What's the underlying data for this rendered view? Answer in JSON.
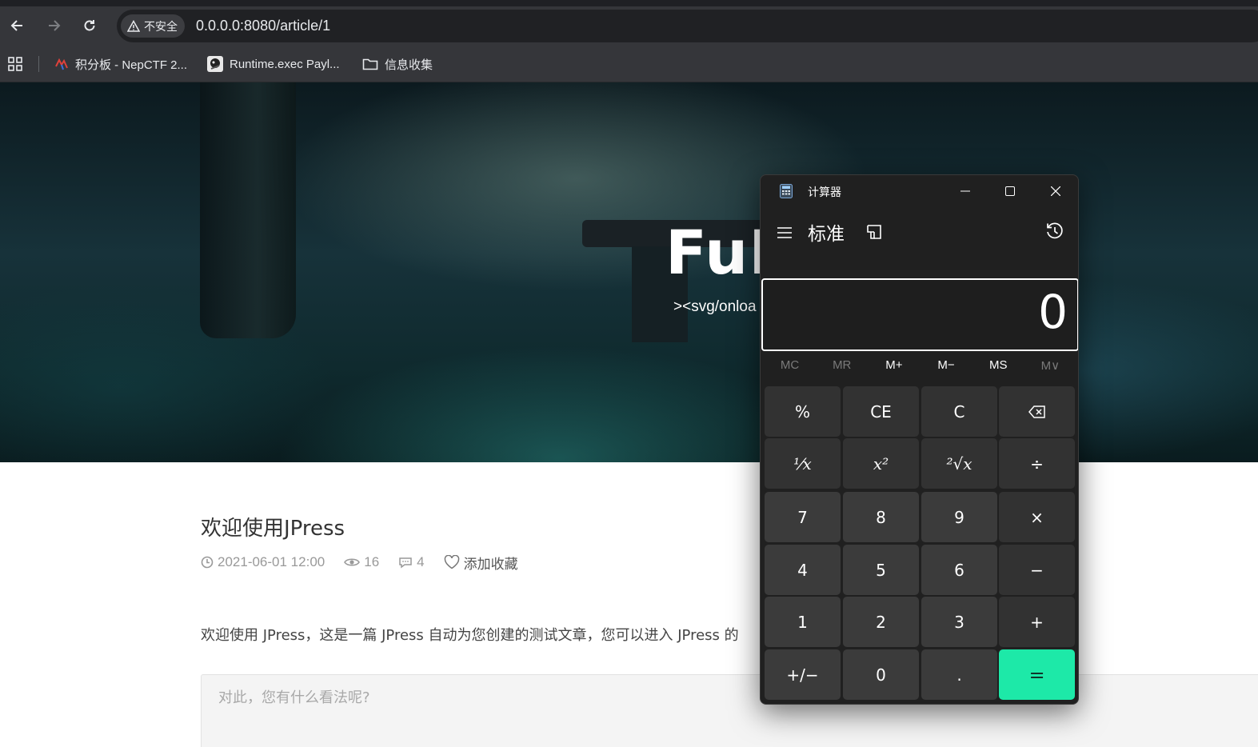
{
  "browser": {
    "security_label": "不安全",
    "url": "0.0.0.0:8080/article/1",
    "bookmarks": [
      {
        "label": "积分板 - NepCTF 2...",
        "icon": "nep-ctf-favicon"
      },
      {
        "label": "Runtime.exec Payl...",
        "icon": "runtime-exec-favicon"
      },
      {
        "label": "信息收集",
        "icon": "folder-icon"
      }
    ]
  },
  "hero": {
    "title": "FuB",
    "subtitle": "><svg/onloa"
  },
  "article": {
    "title": "欢迎使用JPress",
    "date": "2021-06-01 12:00",
    "views": "16",
    "comments": "4",
    "favorite_label": "添加收藏",
    "body": "欢迎使用 JPress，这是一篇 JPress 自动为您创建的测试文章，您可以进入 JPress 的",
    "comment_placeholder": "对此，您有什么看法呢?"
  },
  "calculator": {
    "window_title": "计算器",
    "mode": "标准",
    "display": "0",
    "memory": [
      "MC",
      "MR",
      "M+",
      "M−",
      "MS",
      "M∨"
    ],
    "memory_enabled": [
      false,
      false,
      true,
      true,
      true,
      false
    ],
    "keys": {
      "percent": "%",
      "ce": "CE",
      "c": "C",
      "reciprocal": "¹⁄x",
      "square": "x²",
      "sqrt": "²√x",
      "divide": "÷",
      "seven": "7",
      "eight": "8",
      "nine": "9",
      "multiply": "×",
      "four": "4",
      "five": "5",
      "six": "6",
      "minus": "−",
      "one": "1",
      "two": "2",
      "three": "3",
      "plus": "+",
      "negate": "+/−",
      "zero": "0",
      "decimal": ".",
      "equals": "="
    },
    "colors": {
      "equals": "#1de9a8",
      "background": "#202020"
    }
  }
}
